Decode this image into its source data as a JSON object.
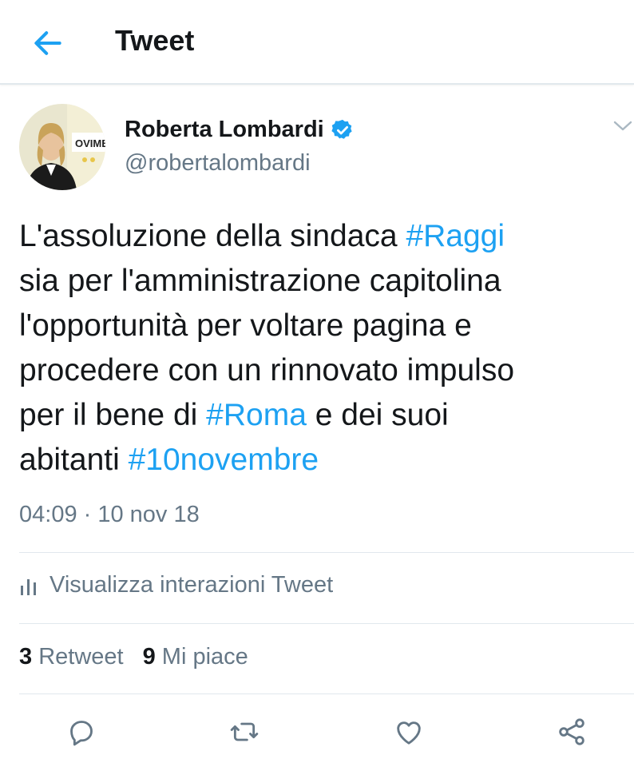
{
  "header": {
    "title": "Tweet"
  },
  "author": {
    "name": "Roberta Lombardi",
    "handle": "@robertalombardi",
    "verified": true,
    "avatar_text": "OVIMEI"
  },
  "tweet": {
    "lines": [
      [
        {
          "text": "L'assoluzione della sindaca ",
          "hashtag": false
        },
        {
          "text": "#Raggi",
          "hashtag": true
        }
      ],
      [
        {
          "text": "sia per l'amministrazione capitolina",
          "hashtag": false
        }
      ],
      [
        {
          "text": "l'opportunità per voltare pagina e",
          "hashtag": false
        }
      ],
      [
        {
          "text": "procedere con un rinnovato impulso",
          "hashtag": false
        }
      ],
      [
        {
          "text": "per il bene di ",
          "hashtag": false
        },
        {
          "text": "#Roma",
          "hashtag": true
        },
        {
          "text": " e dei suoi",
          "hashtag": false
        }
      ],
      [
        {
          "text": "abitanti ",
          "hashtag": false
        },
        {
          "text": "#10novembre",
          "hashtag": true
        }
      ]
    ],
    "timestamp": "04:09 · 10 nov 18"
  },
  "analytics": {
    "label": "Visualizza interazioni Tweet"
  },
  "stats": {
    "retweets_count": "3",
    "retweets_label": "Retweet",
    "likes_count": "9",
    "likes_label": "Mi piace"
  },
  "colors": {
    "accent": "#1da1f2",
    "text": "#14171a",
    "secondary": "#657786",
    "divider": "#e1e8ed"
  },
  "icons": {
    "back": "back-arrow-icon",
    "verified": "verified-badge-icon",
    "more": "chevron-down-icon",
    "analytics": "analytics-bars-icon",
    "reply": "reply-icon",
    "retweet": "retweet-icon",
    "like": "heart-icon",
    "share": "share-icon"
  }
}
